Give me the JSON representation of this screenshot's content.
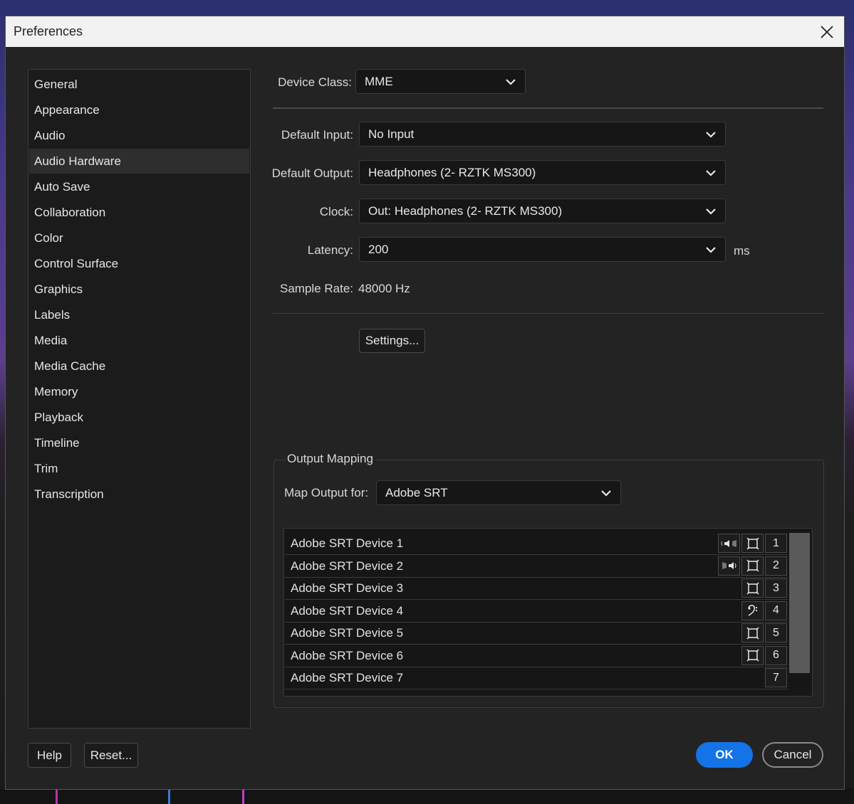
{
  "window": {
    "title": "Preferences"
  },
  "sidebar": {
    "selected": "Audio Hardware",
    "items": [
      {
        "label": "General"
      },
      {
        "label": "Appearance"
      },
      {
        "label": "Audio"
      },
      {
        "label": "Audio Hardware"
      },
      {
        "label": "Auto Save"
      },
      {
        "label": "Collaboration"
      },
      {
        "label": "Color"
      },
      {
        "label": "Control Surface"
      },
      {
        "label": "Graphics"
      },
      {
        "label": "Labels"
      },
      {
        "label": "Media"
      },
      {
        "label": "Media Cache"
      },
      {
        "label": "Memory"
      },
      {
        "label": "Playback"
      },
      {
        "label": "Timeline"
      },
      {
        "label": "Trim"
      },
      {
        "label": "Transcription"
      }
    ]
  },
  "device": {
    "class_label": "Device Class:",
    "class_value": "MME",
    "input_label": "Default Input:",
    "input_value": "No Input",
    "output_label": "Default Output:",
    "output_value": "Headphones (2- RZTK MS300)",
    "clock_label": "Clock:",
    "clock_value": "Out: Headphones (2- RZTK MS300)",
    "latency_label": "Latency:",
    "latency_value": "200",
    "latency_unit": "ms",
    "sample_rate_label": "Sample Rate:",
    "sample_rate_value": "48000 Hz",
    "settings_button": "Settings..."
  },
  "output_mapping": {
    "title": "Output Mapping",
    "map_label": "Map Output for:",
    "map_value": "Adobe SRT",
    "rows": [
      {
        "name": "Adobe SRT Device 1",
        "num": "1",
        "icons": [
          "speaker-left-icon",
          "channel-box-icon"
        ]
      },
      {
        "name": "Adobe SRT Device 2",
        "num": "2",
        "icons": [
          "speaker-right-icon",
          "channel-box-icon"
        ]
      },
      {
        "name": "Adobe SRT Device 3",
        "num": "3",
        "icons": [
          "channel-box-icon"
        ]
      },
      {
        "name": "Adobe SRT Device 4",
        "num": "4",
        "icons": [
          "bass-clef-icon"
        ]
      },
      {
        "name": "Adobe SRT Device 5",
        "num": "5",
        "icons": [
          "channel-box-icon"
        ]
      },
      {
        "name": "Adobe SRT Device 6",
        "num": "6",
        "icons": [
          "channel-box-icon"
        ]
      },
      {
        "name": "Adobe SRT Device 7",
        "num": "7",
        "icons": []
      }
    ]
  },
  "footer": {
    "help": "Help",
    "reset": "Reset...",
    "ok": "OK",
    "cancel": "Cancel"
  },
  "colors": {
    "accent": "#1473e6",
    "dialog_bg": "#232323",
    "panel_bg": "#1b1b1b"
  }
}
